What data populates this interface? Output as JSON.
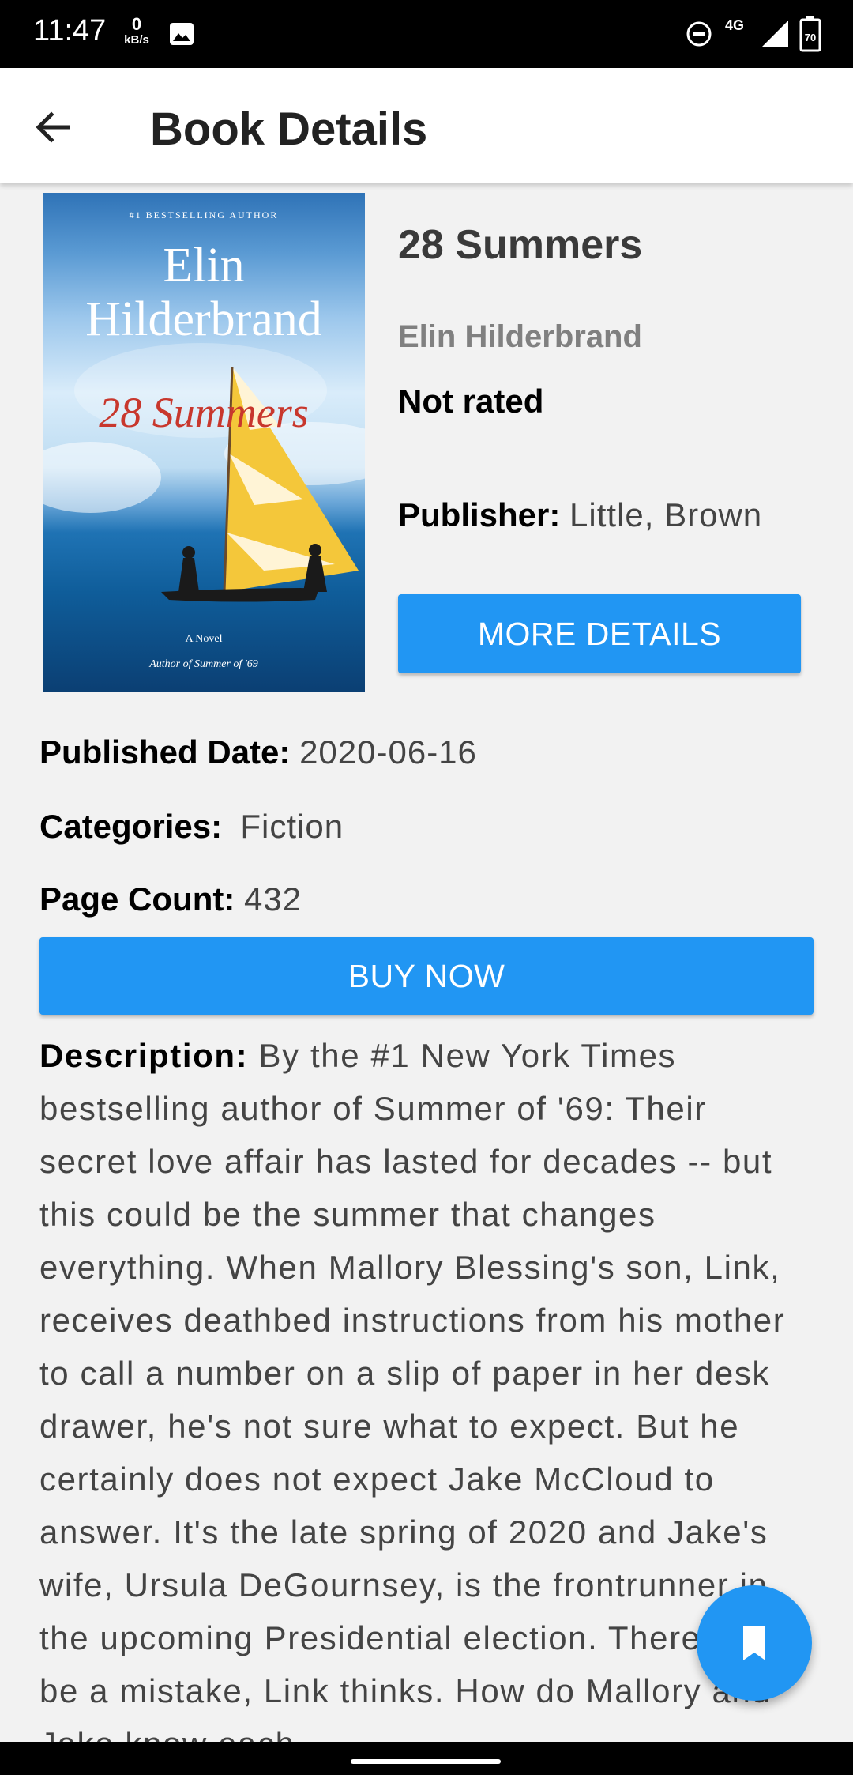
{
  "status_bar": {
    "time": "11:47",
    "net_speed_value": "0",
    "net_speed_unit": "kB/s",
    "network": "4G",
    "battery": "70"
  },
  "app_bar": {
    "title": "Book Details"
  },
  "cover": {
    "top_line": "#1 BESTSELLING AUTHOR",
    "author_first": "Elin",
    "author_last": "Hilderbrand",
    "title": "28 Summers",
    "novel": "A Novel",
    "byline": "Author of Summer of '69"
  },
  "book": {
    "title": "28 Summers",
    "author": "Elin Hilderbrand",
    "rating": "Not rated",
    "publisher_label": "Publisher:",
    "publisher": "Little, Brown",
    "published_label": "Published Date:",
    "published_date": "2020-06-16",
    "categories_label": "Categories:",
    "categories": "Fiction",
    "page_count_label": "Page Count:",
    "page_count": "432",
    "description_label": "Description:",
    "description": "By the #1 New York Times bestselling author of Summer of '69: Their secret love affair has lasted for decades -- but this could be the summer that changes everything. When Mallory Blessing's son, Link, receives deathbed instructions from his mother to call a number on a slip of paper in her desk drawer, he's not sure what to expect. But he certainly does not expect Jake McCloud to answer. It's the late spring of 2020 and Jake's wife, Ursula DeGournsey, is the frontrunner in the upcoming Presidential election. There must be a mistake, Link thinks. How do Mallory and Jake know each"
  },
  "actions": {
    "more_details": "MORE DETAILS",
    "buy_now": "BUY NOW"
  },
  "colors": {
    "primary": "#2196f3",
    "background": "#f2f2f2"
  }
}
